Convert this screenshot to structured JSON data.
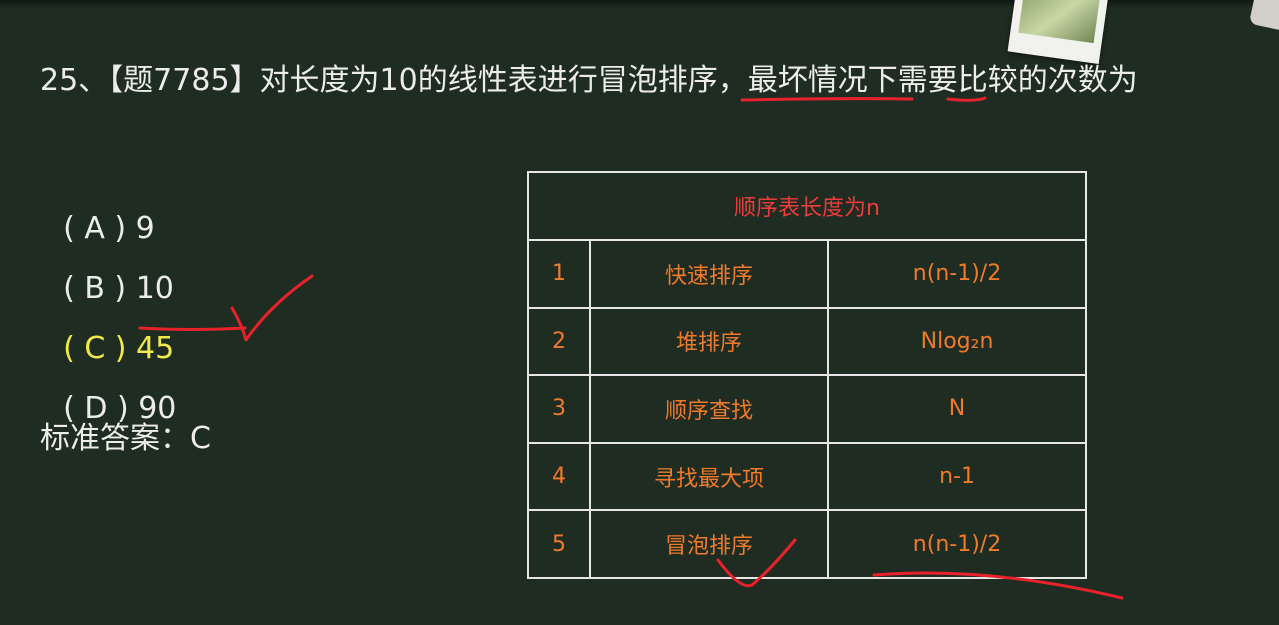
{
  "question": {
    "number": "25、",
    "tag": "【题7785】",
    "text": "对长度为10的线性表进行冒泡排序，最坏情况下需要比较的次数为"
  },
  "options": [
    {
      "label": "( A ) ",
      "value": "9",
      "selected": false
    },
    {
      "label": "( B ) ",
      "value": "10",
      "selected": false
    },
    {
      "label": "( C ) ",
      "value": "45",
      "selected": true
    },
    {
      "label": "( D ) ",
      "value": "90",
      "selected": false
    }
  ],
  "answer": {
    "label": "标准答案：",
    "value": "C"
  },
  "table": {
    "title": "顺序表长度为n",
    "rows": [
      {
        "index": "1",
        "name": "快速排序",
        "complexity": "n(n-1)/2"
      },
      {
        "index": "2",
        "name": "堆排序",
        "complexity": "Nlog₂n"
      },
      {
        "index": "3",
        "name": "顺序查找",
        "complexity": "N"
      },
      {
        "index": "4",
        "name": "寻找最大项",
        "complexity": "n-1"
      },
      {
        "index": "5",
        "name": "冒泡排序",
        "complexity": "n(n-1)/2"
      }
    ]
  },
  "colors": {
    "board": "#1f2c21",
    "text": "#ececec",
    "selected": "#f2ea4a",
    "table_text": "#f07a2a",
    "table_title": "#ee3b3b",
    "annotation": "#e8222a"
  }
}
